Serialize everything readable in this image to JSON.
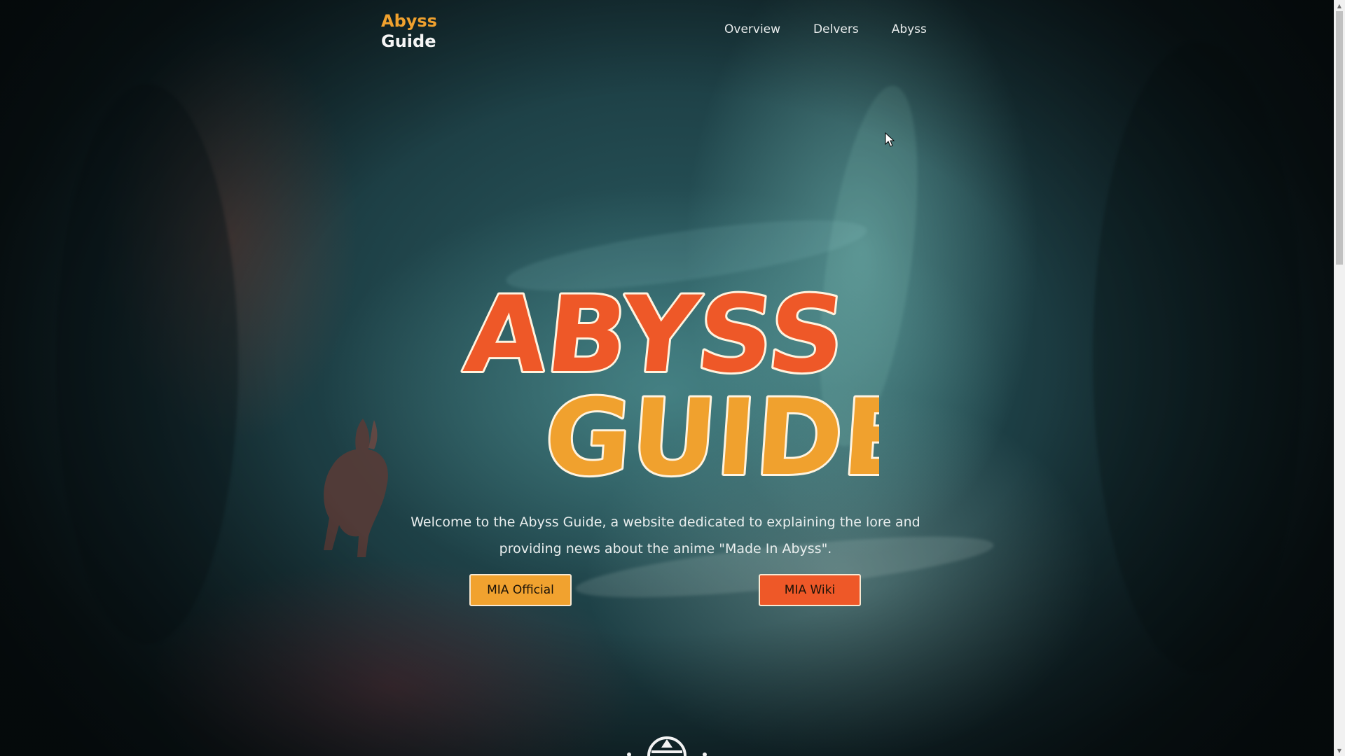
{
  "header": {
    "brand_line1": "Abyss",
    "brand_line2": "Guide",
    "nav": [
      {
        "label": "Overview"
      },
      {
        "label": "Delvers"
      },
      {
        "label": "Abyss"
      }
    ]
  },
  "hero": {
    "logo_line1": "ABYSS",
    "logo_line2": "GUIDE",
    "welcome_text": "Welcome to the Abyss Guide, a website dedicated to explaining the lore and providing news about the anime \"Made In Abyss\".",
    "buttons": {
      "official_label": "MIA Official",
      "wiki_label": "MIA Wiki"
    }
  },
  "colors": {
    "accent_orange": "#f0a12e",
    "accent_red": "#ee5828",
    "logo_dark": "#3b2a1c"
  },
  "icons": {
    "emblem": "abyss-emblem-icon",
    "cursor": "mouse-cursor-icon"
  }
}
